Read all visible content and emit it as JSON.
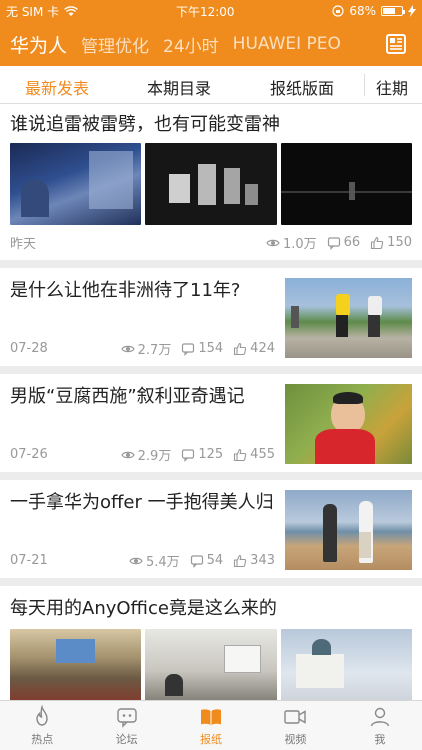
{
  "status_bar": {
    "carrier": "无 SIM 卡",
    "time": "下午12:00",
    "battery_percent": "68%",
    "battery_level": 0.68
  },
  "channels": {
    "items": [
      "华为人",
      "管理优化",
      "24小时",
      "HUAWEI PEO"
    ],
    "active_index": 0
  },
  "sub_tabs": {
    "items": [
      "最新发表",
      "本期目录",
      "报纸版面",
      "往期"
    ],
    "active_index": 0
  },
  "articles": [
    {
      "title": "谁说追雷被雷劈，也有可能变雷神",
      "date": "昨天",
      "views": "1.0万",
      "comments": "66",
      "likes": "150"
    },
    {
      "title": "是什么让他在非洲待了11年?",
      "date": "07-28",
      "views": "2.7万",
      "comments": "154",
      "likes": "424"
    },
    {
      "title": "男版“豆腐西施”叙利亚奇遇记",
      "date": "07-26",
      "views": "2.9万",
      "comments": "125",
      "likes": "455"
    },
    {
      "title": "一手拿华为offer 一手抱得美人归",
      "date": "07-21",
      "views": "5.4万",
      "comments": "54",
      "likes": "343"
    },
    {
      "title": "每天用的AnyOffice竟是这么来的"
    }
  ],
  "tab_bar": {
    "items": [
      {
        "label": "热点",
        "icon": "flame-icon"
      },
      {
        "label": "论坛",
        "icon": "chat-robot-icon"
      },
      {
        "label": "报纸",
        "icon": "open-book-icon"
      },
      {
        "label": "视频",
        "icon": "video-camera-icon"
      },
      {
        "label": "我",
        "icon": "person-icon"
      }
    ],
    "active_index": 2
  },
  "colors": {
    "accent": "#f08c1e",
    "muted": "#999999"
  }
}
